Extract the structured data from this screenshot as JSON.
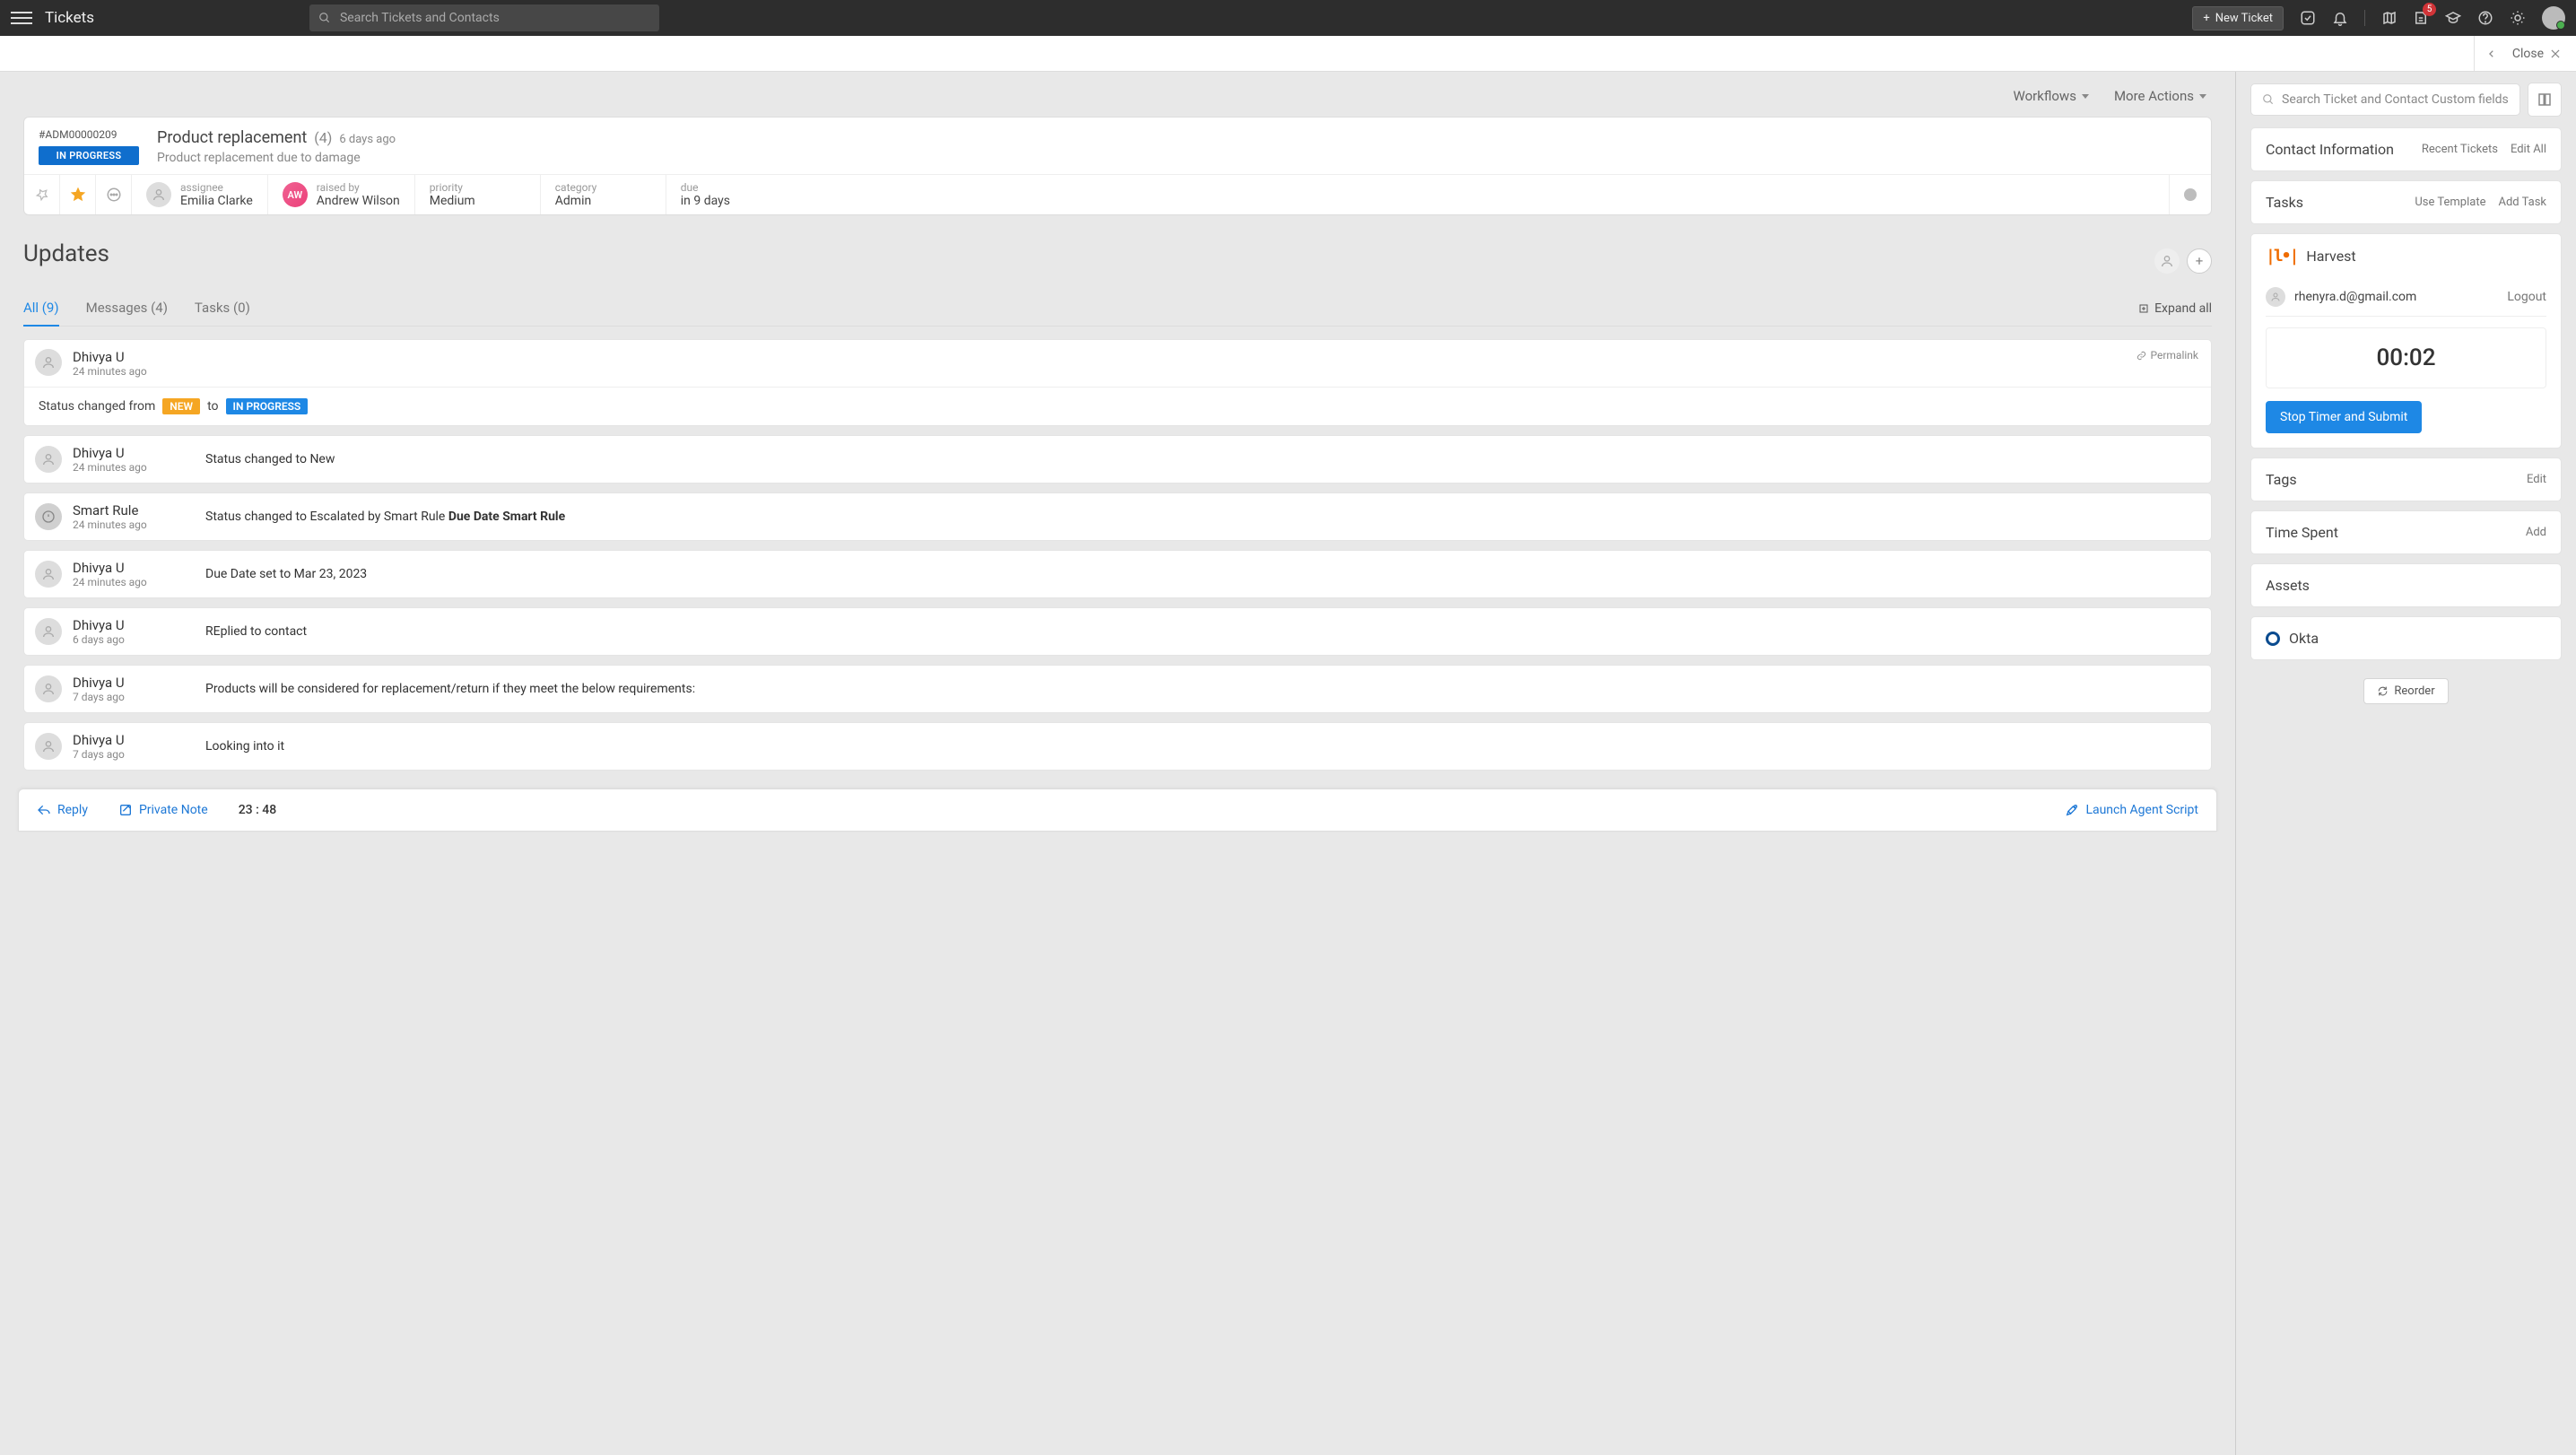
{
  "topbar": {
    "title": "Tickets",
    "search_placeholder": "Search Tickets and Contacts",
    "new_ticket_label": "New Ticket",
    "notif_badge": "5"
  },
  "closebar": {
    "close_label": "Close"
  },
  "actions": {
    "workflows": "Workflows",
    "more": "More Actions"
  },
  "ticket": {
    "id": "#ADM00000209",
    "status": "IN PROGRESS",
    "title": "Product replacement",
    "count": "(4)",
    "age": "6 days ago",
    "desc": "Product replacement due to damage",
    "assignee_label": "assignee",
    "assignee": "Emilia Clarke",
    "raised_label": "raised by",
    "raised_by": "Andrew Wilson",
    "raised_initials": "AW",
    "priority_label": "priority",
    "priority": "Medium",
    "category_label": "category",
    "category": "Admin",
    "due_label": "due",
    "due": "in 9 days"
  },
  "updates": {
    "title": "Updates",
    "tabs": {
      "all": "All (9)",
      "messages": "Messages (4)",
      "tasks": "Tasks (0)"
    },
    "expand_all": "Expand all",
    "permalink": "Permalink",
    "status_prefix": "Status changed from",
    "status_to": "to",
    "status_from_chip": "NEW",
    "status_to_chip": "IN PROGRESS",
    "items": [
      {
        "author": "Dhivya U",
        "time": "24 minutes ago",
        "expanded": true
      },
      {
        "author": "Dhivya U",
        "time": "24 minutes ago",
        "content": "Status changed to New"
      },
      {
        "author": "Smart Rule",
        "time": "24 minutes ago",
        "content_prefix": "Status changed to Escalated by Smart Rule ",
        "content_bold": "Due Date Smart Rule",
        "rule": true
      },
      {
        "author": "Dhivya U",
        "time": "24 minutes ago",
        "content": "Due Date set to Mar 23, 2023"
      },
      {
        "author": "Dhivya U",
        "time": "6 days ago",
        "content": "REplied to contact"
      },
      {
        "author": "Dhivya U",
        "time": "7 days ago",
        "content": "Products will be considered for replacement/return if they meet the below requirements:"
      },
      {
        "author": "Dhivya U",
        "time": "7 days ago",
        "content": "Looking into it"
      }
    ]
  },
  "bottombar": {
    "reply": "Reply",
    "private_note": "Private Note",
    "timer": "23 : 48",
    "launch": "Launch Agent Script"
  },
  "right": {
    "search_placeholder": "Search Ticket and Contact Custom fields",
    "contact": {
      "title": "Contact Information",
      "recent": "Recent Tickets",
      "edit": "Edit All"
    },
    "tasks": {
      "title": "Tasks",
      "template": "Use Template",
      "add": "Add Task"
    },
    "harvest": {
      "title": "Harvest",
      "email": "rhenyra.d@gmail.com",
      "logout": "Logout",
      "timer": "00:02",
      "stop": "Stop Timer and Submit"
    },
    "tags": {
      "title": "Tags",
      "edit": "Edit"
    },
    "timespent": {
      "title": "Time Spent",
      "add": "Add"
    },
    "assets": {
      "title": "Assets"
    },
    "okta": {
      "title": "Okta"
    },
    "reorder": "Reorder"
  }
}
